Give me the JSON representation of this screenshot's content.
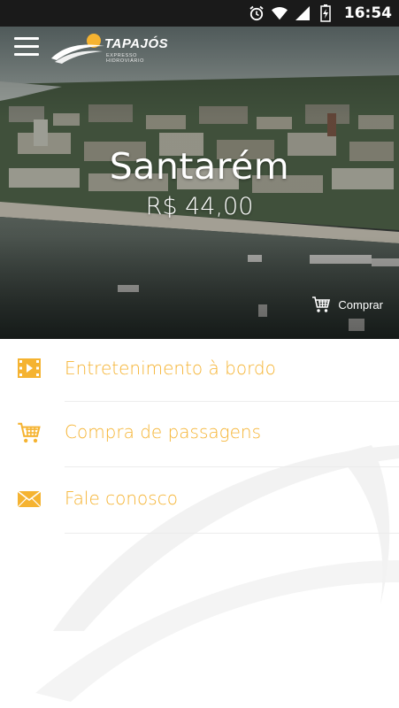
{
  "status_bar": {
    "time": "16:54"
  },
  "app": {
    "brand": "TAPAJÓS",
    "tagline": "EXPRESSO HIDROVIÁRIO"
  },
  "hero": {
    "city": "Santarém",
    "price": "R$ 44,00",
    "buy_label": "Comprar"
  },
  "menu": {
    "items": [
      {
        "label": "Entretenimento à bordo",
        "icon": "video-icon"
      },
      {
        "label": "Compra de passagens",
        "icon": "cart-icon"
      },
      {
        "label": "Fale conosco",
        "icon": "mail-icon"
      }
    ]
  },
  "colors": {
    "accent": "#f5b331",
    "status_bar": "#1a1a1a"
  }
}
